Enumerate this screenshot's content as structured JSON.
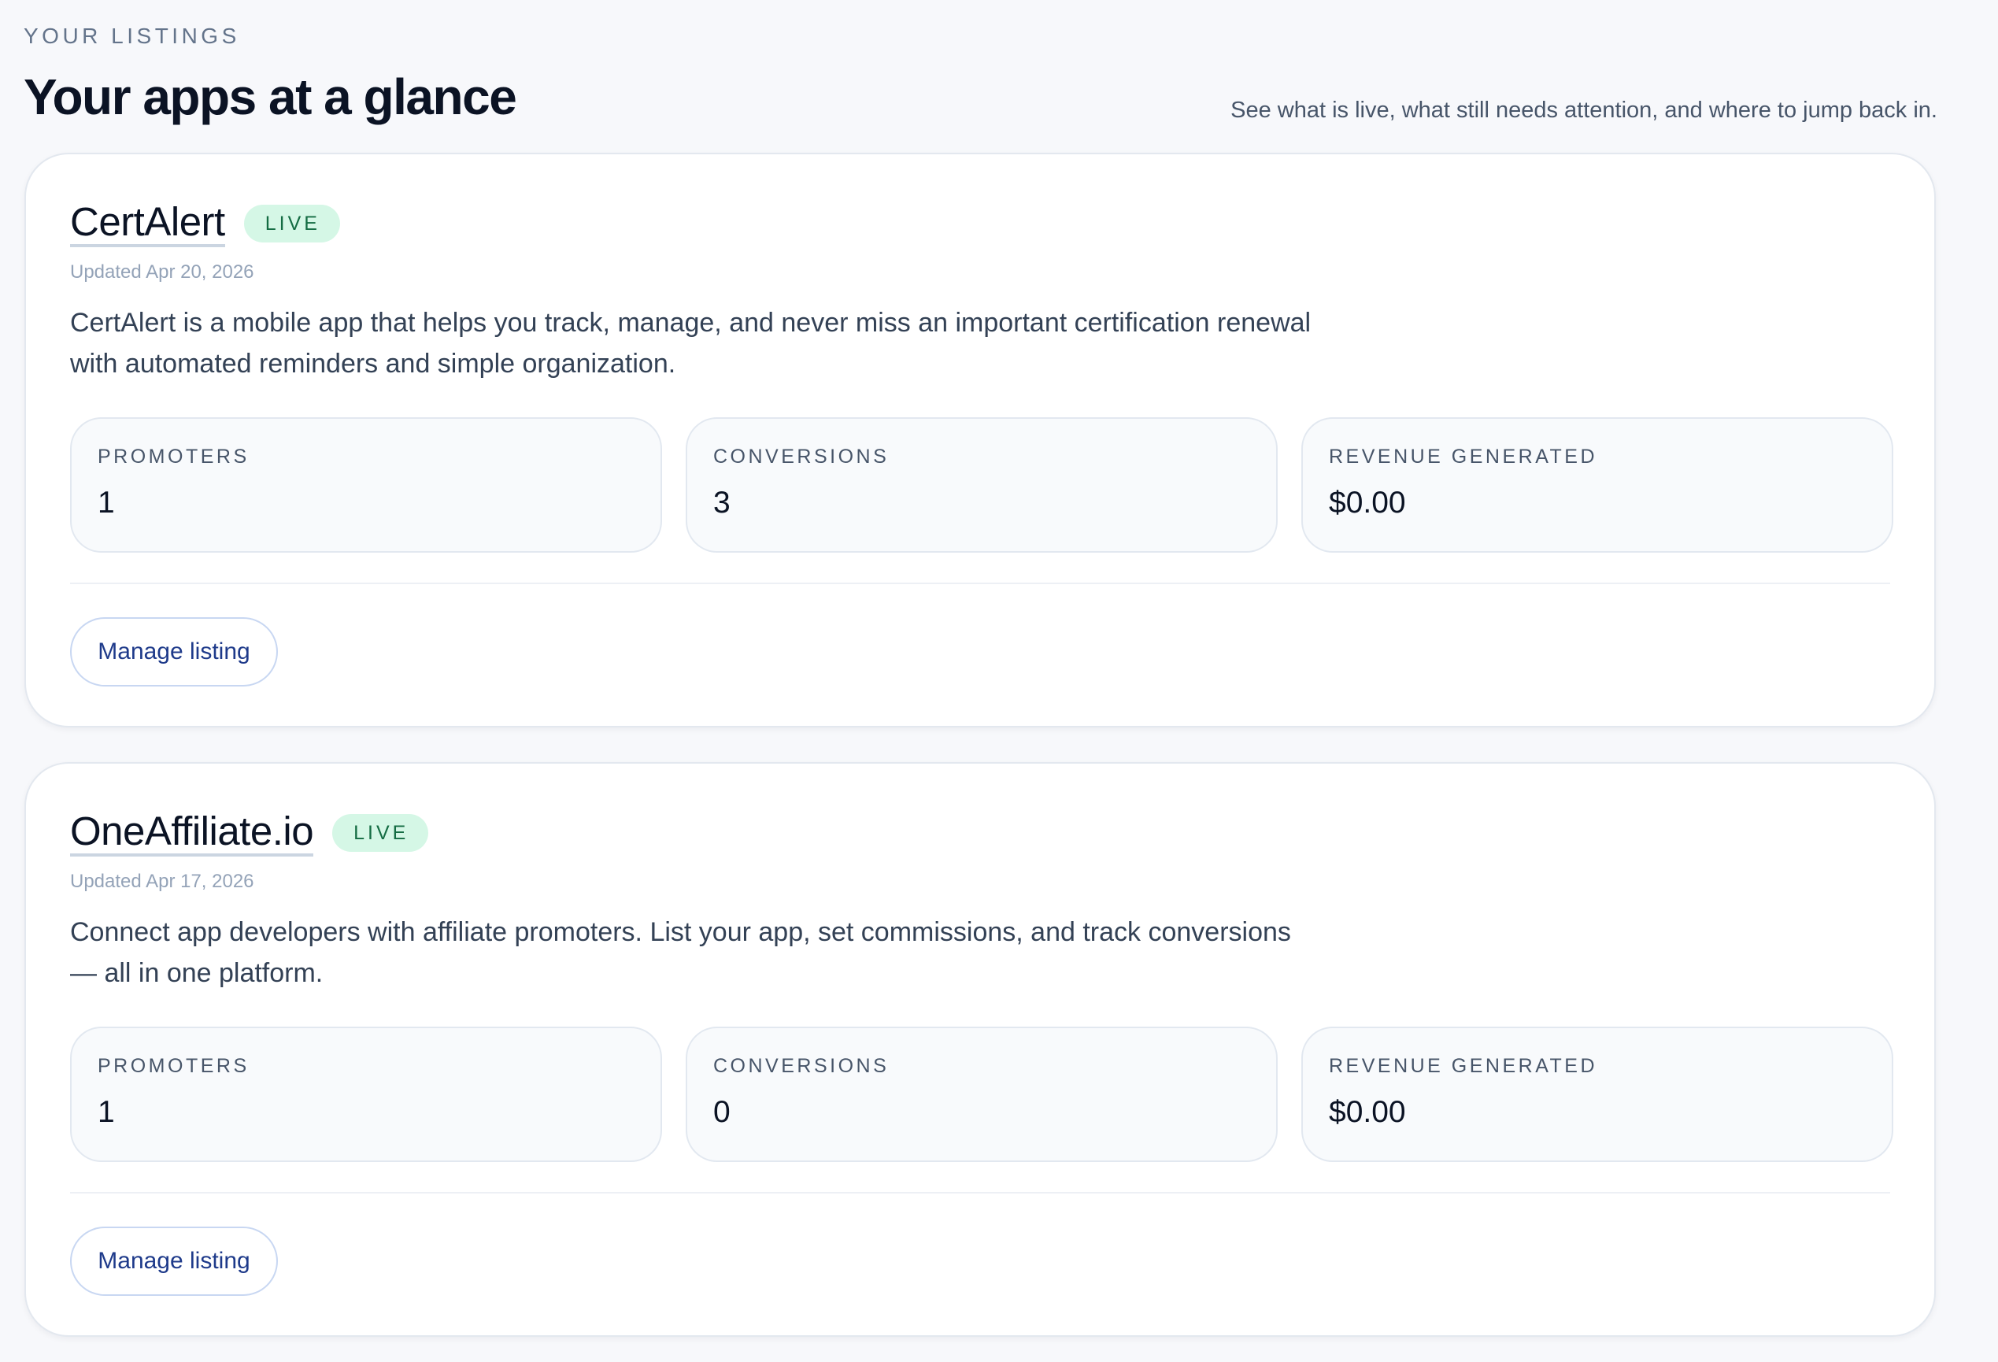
{
  "header": {
    "eyebrow": "YOUR LISTINGS",
    "title": "Your apps at a glance",
    "subtitle": "See what is live, what still needs attention, and where to jump back in."
  },
  "listings": [
    {
      "name": "CertAlert",
      "status": "LIVE",
      "updated": "Updated Apr 20, 2026",
      "description": "CertAlert is a mobile app that helps you track, manage, and never miss an important certification renewal with automated reminders and simple organization.",
      "stats": [
        {
          "label": "PROMOTERS",
          "value": "1"
        },
        {
          "label": "CONVERSIONS",
          "value": "3"
        },
        {
          "label": "REVENUE GENERATED",
          "value": "$0.00"
        }
      ],
      "action_label": "Manage listing"
    },
    {
      "name": "OneAffiliate.io",
      "status": "LIVE",
      "updated": "Updated Apr 17, 2026",
      "description": "Connect app developers with affiliate promoters. List your app, set commissions, and track conversions — all in one platform.",
      "stats": [
        {
          "label": "PROMOTERS",
          "value": "1"
        },
        {
          "label": "CONVERSIONS",
          "value": "0"
        },
        {
          "label": "REVENUE GENERATED",
          "value": "$0.00"
        }
      ],
      "action_label": "Manage listing"
    }
  ],
  "colors": {
    "background": "#f7f8fb",
    "badge_bg": "#d5f7e6",
    "badge_text": "#146c43",
    "button_text": "#1e3a8a",
    "button_border": "#c8d7f2"
  }
}
